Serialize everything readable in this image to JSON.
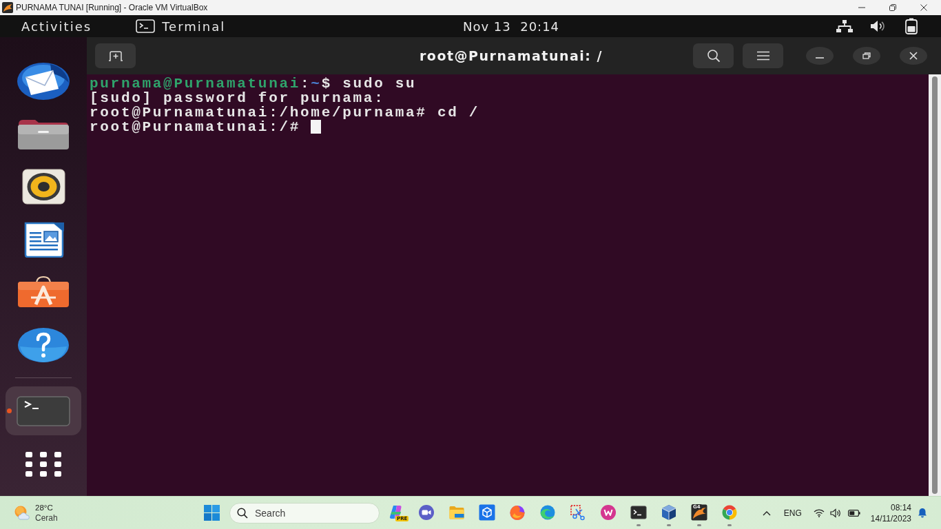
{
  "vm_window": {
    "title": "PURNAMA TUNAI [Running] - Oracle VM VirtualBox"
  },
  "top_bar": {
    "activities": "Activities",
    "app_menu": "Terminal",
    "clock": "Nov 13  20:14"
  },
  "dock": {
    "favorites": [
      {
        "kind": "mail",
        "running": false,
        "selected": false
      },
      {
        "kind": "folder",
        "running": false,
        "selected": false
      },
      {
        "kind": "speaker",
        "running": false,
        "selected": false
      },
      {
        "kind": "document",
        "running": false,
        "selected": false
      },
      {
        "kind": "bag",
        "running": false,
        "selected": false
      },
      {
        "kind": "help",
        "running": false,
        "selected": false
      }
    ],
    "open_apps": [
      {
        "kind": "terminal",
        "running": true,
        "selected": true
      }
    ]
  },
  "terminal": {
    "title": "root@Purnamatunai: /",
    "lines": [
      {
        "segments": [
          {
            "text": "purnama@Purnamatunai",
            "kind": "user"
          },
          {
            "text": ":",
            "kind": "plain"
          },
          {
            "text": "~",
            "kind": "path"
          },
          {
            "text": "$ sudo su",
            "kind": "plain"
          }
        ]
      },
      {
        "segments": [
          {
            "text": "[sudo] password for purnama:",
            "kind": "plain"
          }
        ]
      },
      {
        "segments": [
          {
            "text": "root@Purnamatunai:/home/purnama# cd /",
            "kind": "plain"
          }
        ]
      },
      {
        "segments": [
          {
            "text": "root@Purnamatunai:/#",
            "kind": "plain"
          }
        ]
      }
    ],
    "cursor_visible": true
  },
  "taskbar": {
    "weather": {
      "temperature": "28°C",
      "condition": "Cerah"
    },
    "search": {
      "placeholder": "Search"
    },
    "apps": [
      {
        "kind": "swirl",
        "badge": "PRE",
        "running": false
      },
      {
        "kind": "camera",
        "running": false
      },
      {
        "kind": "folder",
        "running": false
      },
      {
        "kind": "cube-tile",
        "running": false
      },
      {
        "kind": "flame",
        "running": false
      },
      {
        "kind": "wave",
        "running": false
      },
      {
        "kind": "scissors",
        "running": false
      },
      {
        "kind": "zigzag",
        "running": false
      },
      {
        "kind": "terminal",
        "running": true
      },
      {
        "kind": "cube",
        "running": true
      },
      {
        "kind": "vm",
        "badge": "G4",
        "running": true
      },
      {
        "kind": "wheel",
        "running": true
      }
    ],
    "tray": {
      "language": "ENG",
      "time": "08:14",
      "date": "14/11/2023"
    }
  }
}
